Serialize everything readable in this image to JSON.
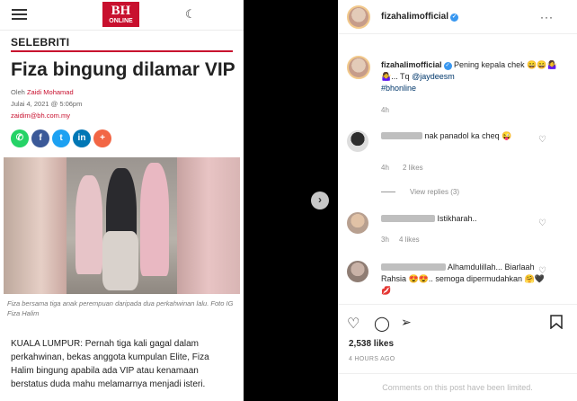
{
  "article": {
    "logo_main": "BH",
    "logo_sub": "ONLINE",
    "section": "SELEBRITI",
    "headline": "Fiza bingung dilamar VIP",
    "byline_prefix": "Oleh",
    "author": "Zaidi Mohamad",
    "date": "Julai 4, 2021 @ 5:06pm",
    "email": "zaidim@bh.com.my",
    "share_icons": [
      "whatsapp-icon",
      "facebook-icon",
      "twitter-icon",
      "linkedin-icon",
      "more-share-icon"
    ],
    "share_glyphs": [
      "✆",
      "f",
      "t",
      "in",
      "+"
    ],
    "share_colors": [
      "#25d366",
      "#3b5998",
      "#1da1f2",
      "#0077b5",
      "#f26645"
    ],
    "caption": "Fiza bersama tiga anak perempuan daripada dua perkahwinan lalu. Foto IG Fiza Halim",
    "body": "KUALA LUMPUR: Pernah tiga kali gagal dalam perkahwinan, bekas anggota kumpulan Elite, Fiza Halim bingung apabila ada VIP atau kenamaan berstatus duda mahu melamarnya menjadi isteri."
  },
  "instagram": {
    "username": "fizahalimofficial",
    "more_label": "···",
    "caption_text": "Pening kepala chek 😄😄🤷‍♀️🤷‍♀️... Tq",
    "mention": "@jaydeesm",
    "hashtag": "#bhonline",
    "caption_time": "4h",
    "comments": [
      {
        "text": "nak panadol ka cheq 😜",
        "time": "4h",
        "likes": "2 likes"
      },
      {
        "text": "Istikharah..",
        "time": "3h",
        "likes": "4 likes"
      },
      {
        "text": "Alhamdulillah... Biarlaah Rahsia 😍😍.. semoga dipermudahkan 🤗🖤💋",
        "time": "",
        "likes": ""
      }
    ],
    "view_replies": "View replies (3)",
    "likes_count": "2,538 likes",
    "post_time": "4 HOURS AGO",
    "comments_limited": "Comments on this post have been limited."
  },
  "colors": {
    "brand_red": "#c8102e",
    "ig_link": "#00376b",
    "verified_blue": "#3897f0"
  }
}
